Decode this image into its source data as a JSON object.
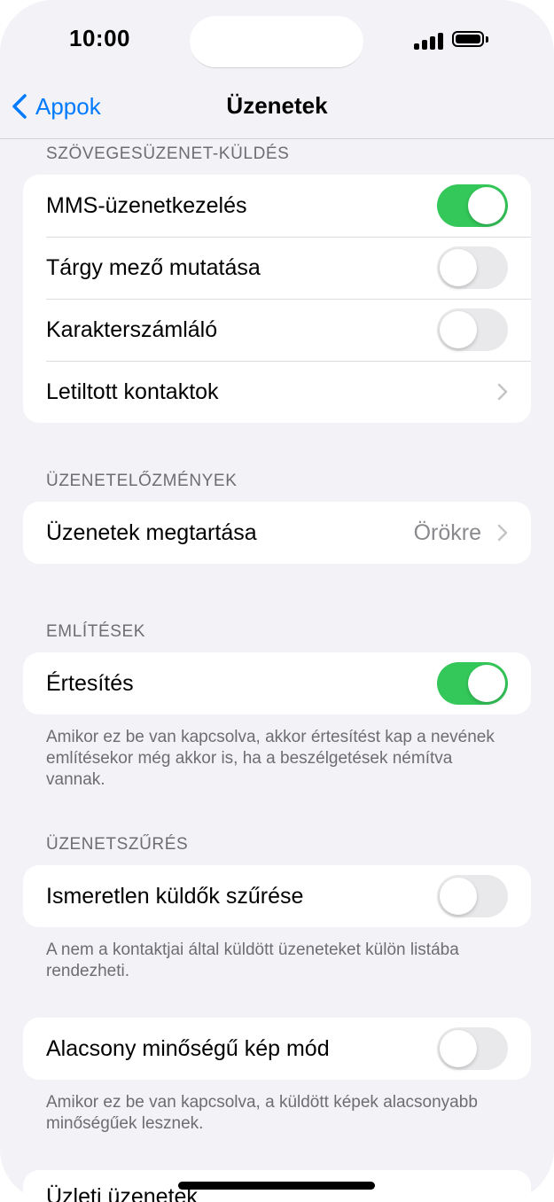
{
  "status_bar": {
    "time": "10:00"
  },
  "nav": {
    "back_label": "Appok",
    "title": "Üzenetek"
  },
  "sections": {
    "sms": {
      "header": "SZÖVEGESÜZENET-KÜLDÉS",
      "rows": [
        {
          "label": "MMS-üzenetkezelés",
          "toggle": true
        },
        {
          "label": "Tárgy mező mutatása",
          "toggle": false
        },
        {
          "label": "Karakterszámláló",
          "toggle": false
        },
        {
          "label": "Letiltott kontaktok"
        }
      ]
    },
    "history": {
      "header": "ÜZENETELŐZMÉNYEK",
      "rows": [
        {
          "label": "Üzenetek megtartása",
          "value": "Örökre"
        }
      ]
    },
    "mentions": {
      "header": "EMLÍTÉSEK",
      "rows": [
        {
          "label": "Értesítés",
          "toggle": true
        }
      ],
      "footer": "Amikor ez be van kapcsolva, akkor értesítést kap a nevének említésekor még akkor is, ha a beszélgetések némítva vannak."
    },
    "filtering": {
      "header": "ÜZENETSZŰRÉS",
      "rows": [
        {
          "label": "Ismeretlen küldők szűrése",
          "toggle": false
        }
      ],
      "footer": "A nem a kontaktjai által küldött üzeneteket külön listába rendezheti."
    },
    "low_quality": {
      "rows": [
        {
          "label": "Alacsony minőségű kép mód",
          "toggle": false
        }
      ],
      "footer": "Amikor ez be van kapcsolva, a küldött képek alacsonyabb minőségűek lesznek."
    },
    "business": {
      "rows": [
        {
          "label": "Üzleti üzenetek"
        }
      ]
    }
  },
  "colors": {
    "accent": "#007aff",
    "toggle_on": "#34c759",
    "toggle_off": "#e9e9eb",
    "background": "#f2f2f7"
  }
}
